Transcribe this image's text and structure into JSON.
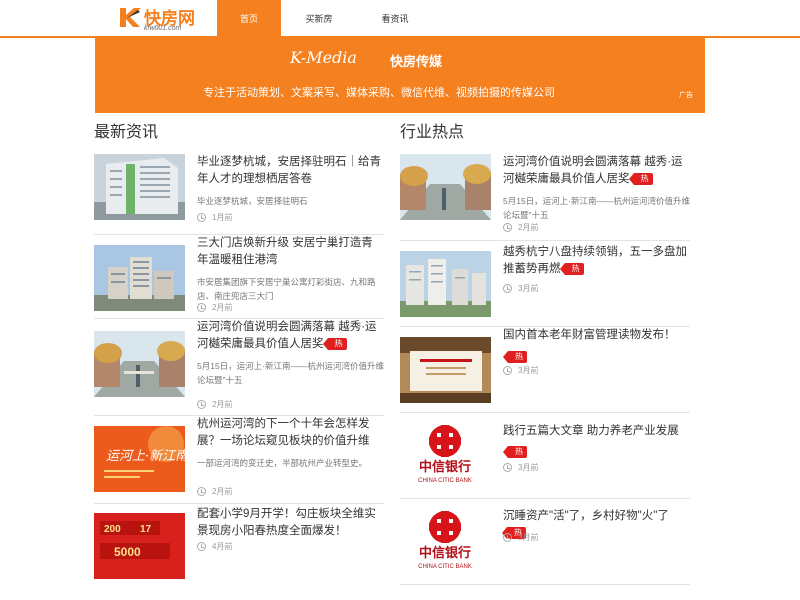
{
  "header": {
    "logo_name": "快房网",
    "logo_url": "kfw001.com",
    "nav": [
      "首页",
      "买新房",
      "看资讯"
    ]
  },
  "banner": {
    "kmedia": "K-Media",
    "brand": "快房传媒",
    "slogan": "专注于活动策划、文案采写、媒体采购、微信代维、视频拍摄的传媒公司",
    "ad_tag": "广告"
  },
  "left": {
    "title": "最新资讯",
    "items": [
      {
        "title": "毕业逐梦杭城，安居择驻明石｜给青年人才的理想栖居答卷",
        "hot": "",
        "desc": "毕业逐梦杭城，安居择驻明石",
        "time": "1月前"
      },
      {
        "title": "三大门店焕新升级 安居宁巢打造青年温暖租住港湾",
        "hot": "",
        "desc": "市安居集团旗下安居宁巢公寓灯彩街店、九和路店、南庄兜店三大门",
        "time": "2月前"
      },
      {
        "title": "运河湾价值说明会圆满落幕 越秀·运河樾荣庸最具价值人居奖",
        "hot": "热",
        "desc": "5月15日，运河上·新江南——杭州运河湾价值升维论坛暨\"十五",
        "time": "2月前"
      },
      {
        "title": "杭州运河湾的下一个十年会怎样发展？一场论坛窥见板块的价值升维",
        "hot": "",
        "desc": "一部运河湾的变迁史，半部杭州产业转型史。",
        "time": "2月前"
      },
      {
        "title": "配套小学9月开学！勾庄板块全维实景现房小阳春热度全面爆发！",
        "hot": "",
        "desc": "",
        "time": "4月前"
      }
    ]
  },
  "right": {
    "title": "行业热点",
    "items": [
      {
        "title": "运河湾价值说明会圆满落幕 越秀·运河樾荣庸最具价值人居奖",
        "hot": "热",
        "desc": "5月15日，运河上·新江南——杭州运河湾价值升维论坛暨\"十五",
        "time": "2月前"
      },
      {
        "title": "越秀杭宁八盘持续领销，五一多盘加推蓄势再燃",
        "hot": "热",
        "desc": "",
        "time": "3月前"
      },
      {
        "title": "国内首本老年财富管理读物发布！",
        "hot": "热",
        "desc": "",
        "time": "3月前"
      },
      {
        "title": "践行五篇大文章 助力养老产业发展",
        "hot": "热",
        "desc": "",
        "time": "3月前"
      },
      {
        "title": "沉睡资产\"活\"了，乡村好物\"火\"了",
        "hot": "热",
        "desc": "",
        "time": "3月前"
      }
    ]
  },
  "thumb_labels": {
    "citic_cn": "中信银行",
    "citic_en": "CHINA CITIC BANK",
    "canal_text": "运河上·新江南",
    "ad_price_1": "200",
    "ad_price_2": "17",
    "ad_price_3": "5000"
  },
  "colors": {
    "accent": "#f5801f",
    "hot": "#e02020",
    "citic": "#d7141a"
  }
}
